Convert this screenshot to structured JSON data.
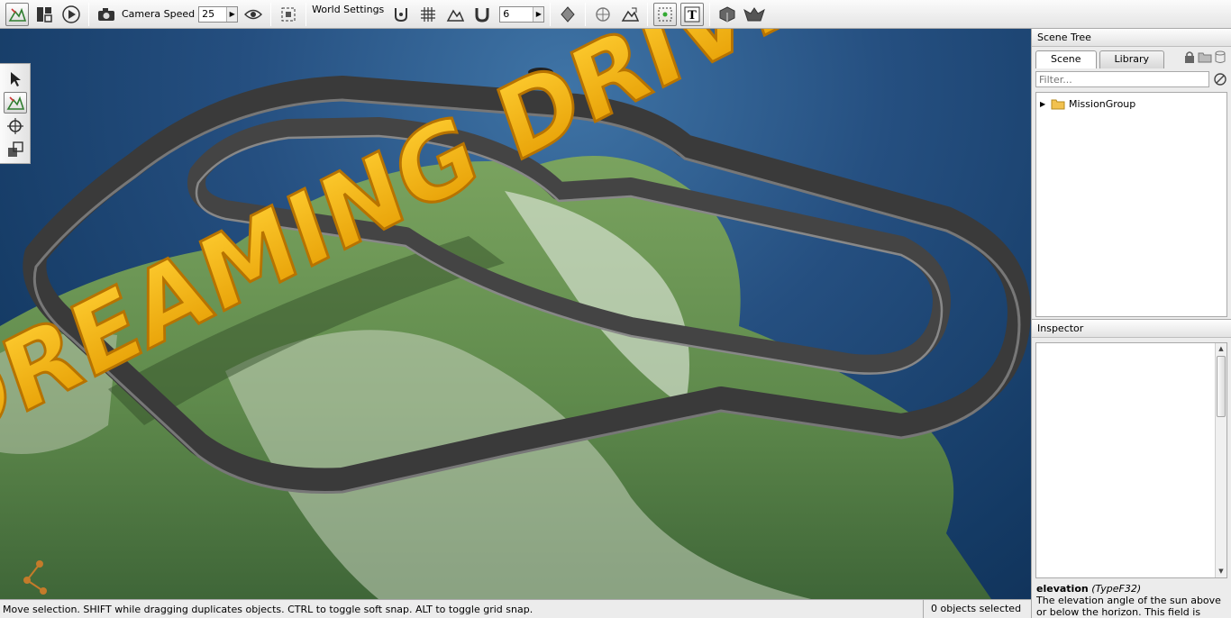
{
  "toolbar": {
    "camera_speed_label": "Camera Speed",
    "camera_speed_value": "25",
    "world_settings_label": "World Settings",
    "snap_value": "6"
  },
  "scene_tree": {
    "title": "Scene Tree",
    "tabs": [
      {
        "label": "Scene",
        "active": true
      },
      {
        "label": "Library",
        "active": false
      }
    ],
    "filter_placeholder": "Filter...",
    "items": [
      {
        "label": "MissionGroup",
        "icon": "folder-icon",
        "expanded": false
      }
    ]
  },
  "inspector": {
    "title": "Inspector",
    "field_name": "elevation",
    "field_type": "(TypeF32)",
    "field_description": "The elevation angle of the sun above or below the horizon. This field is networked."
  },
  "viewport": {
    "scene_text": "DREAMING DRIVE"
  },
  "status_bar": {
    "message": "Move selection.  SHIFT while dragging duplicates objects.  CTRL to toggle soft snap.  ALT to toggle grid snap.",
    "selection_count": "0 objects selected"
  },
  "colors": {
    "accent_text": "#f5a800",
    "ocean": "#1b4775",
    "terrain": "#6f9a55",
    "road": "#3a3a3a"
  }
}
